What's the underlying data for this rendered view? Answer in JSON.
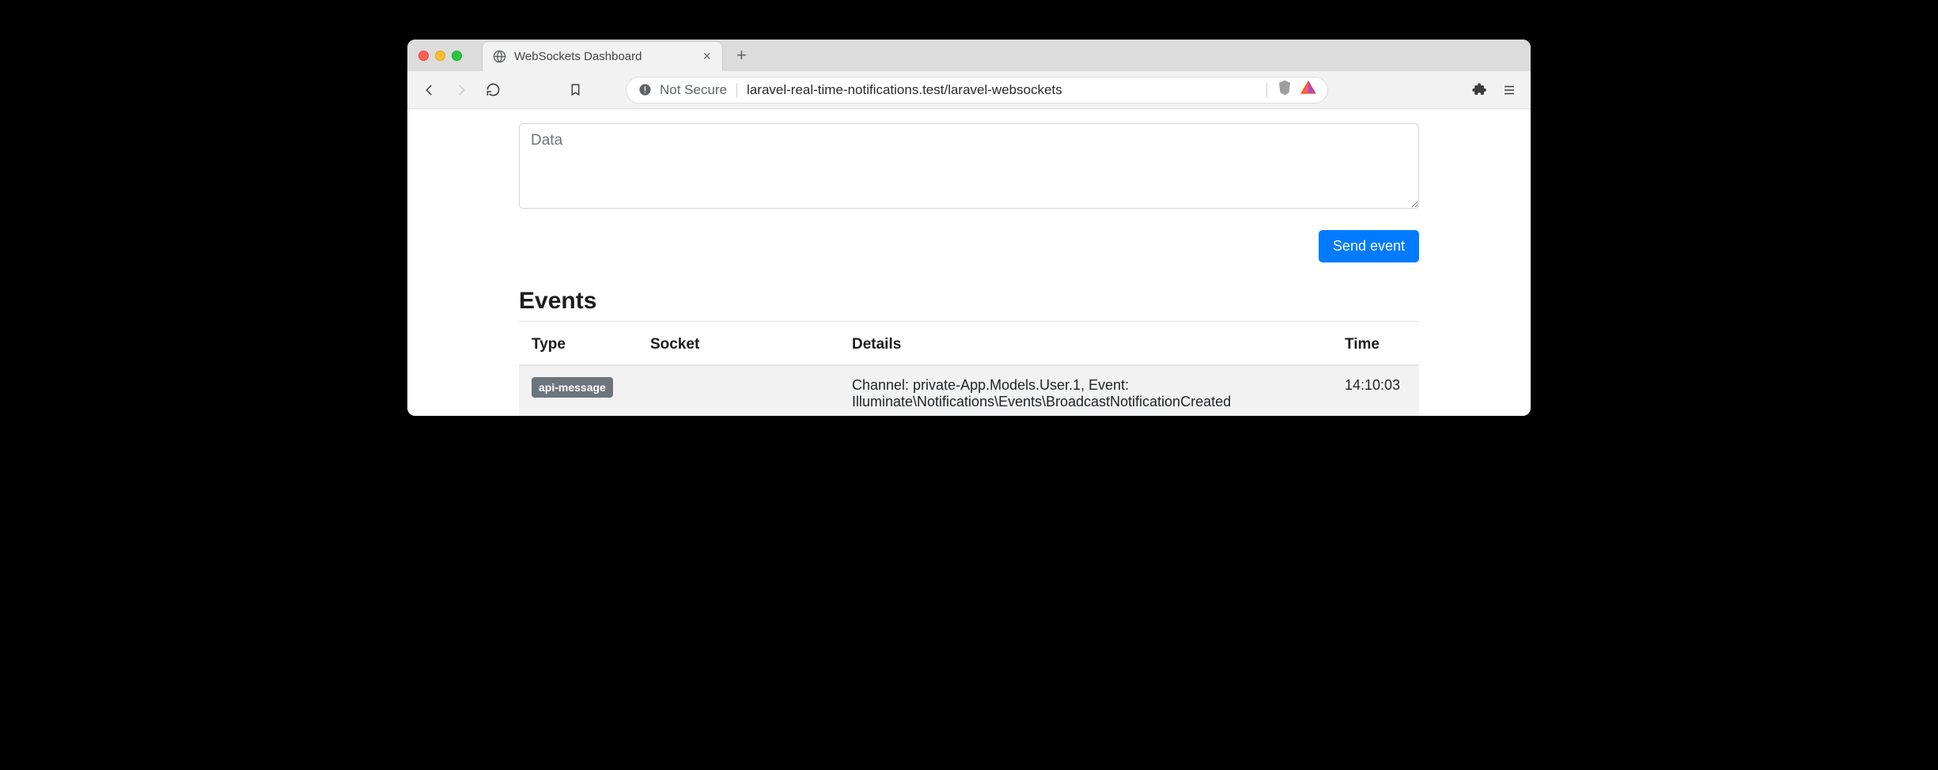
{
  "browser": {
    "tab_title": "WebSockets Dashboard",
    "not_secure_label": "Not Secure",
    "url": "laravel-real-time-notifications.test/laravel-websockets"
  },
  "form": {
    "data_placeholder": "Data",
    "send_button_label": "Send event"
  },
  "events": {
    "heading": "Events",
    "columns": {
      "type": "Type",
      "socket": "Socket",
      "details": "Details",
      "time": "Time"
    },
    "rows": [
      {
        "type_badge": "api-message",
        "socket": "",
        "details": "Channel: private-App.Models.User.1, Event: Illuminate\\Notifications\\Events\\BroadcastNotificationCreated",
        "time": "14:10:03"
      }
    ]
  }
}
